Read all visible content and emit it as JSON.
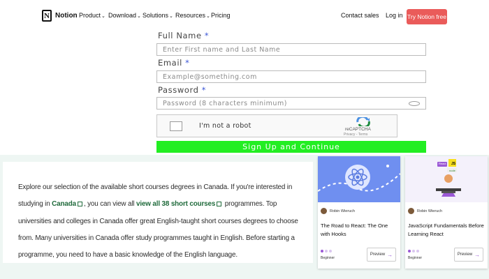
{
  "nav": {
    "logo_letter": "N",
    "brand": "Notion",
    "items": [
      {
        "label": "Product",
        "chevron": "⌄"
      },
      {
        "label": "Download",
        "chevron": "⌄"
      },
      {
        "label": "Solutions",
        "chevron": "⌄"
      },
      {
        "label": "Resources",
        "chevron": "⌄"
      },
      {
        "label": "Pricing",
        "chevron": ""
      }
    ],
    "contact": "Contact sales",
    "login": "Log in",
    "cta": "Try Notion free",
    "cta_color": "#ea5b5a"
  },
  "form": {
    "fullname_label": "Full Name",
    "fullname_placeholder": "Enter First name and Last Name",
    "email_label": "Email",
    "email_placeholder": "Example@something.com",
    "password_label": "Password",
    "password_placeholder": "Password (8 characters minimum)",
    "required_mark": "*",
    "captcha_text": "I'm not a robot",
    "captcha_brand": "reCAPTCHA",
    "captcha_terms": "Privacy - Terms",
    "submit": "Sign Up and Continue",
    "submit_color": "#22ee22"
  },
  "description": {
    "t1": "Explore our selection of the available short courses degrees in Canada. If you're interested in studying in ",
    "link1": "Canada",
    "t2": ", you can view all ",
    "link2": "view all 38 short courses",
    "t3": " programmes. Top universities and colleges in Canada offer great English-taught short courses degrees to choose from. Many universities in Canada offer study programmes taught in English. Before starting a programme, you need to have a basic knowledge of the English language.",
    "link_color": "#1f6a3b"
  },
  "cards": [
    {
      "author": "Robin Wieruch",
      "title": "The Road to React: The One with Hooks",
      "level": "Beginner",
      "preview": "Preview",
      "arrow": "→",
      "thumb_color": "#6f8ff0"
    },
    {
      "author": "Robin Wieruch",
      "title": "JavaScript Fundamentals Before Learning React",
      "level": "Beginner",
      "preview": "Preview",
      "arrow": "→",
      "thumb_color": "#f4f1fb",
      "badges": [
        "React",
        "JS",
        "node"
      ]
    }
  ]
}
